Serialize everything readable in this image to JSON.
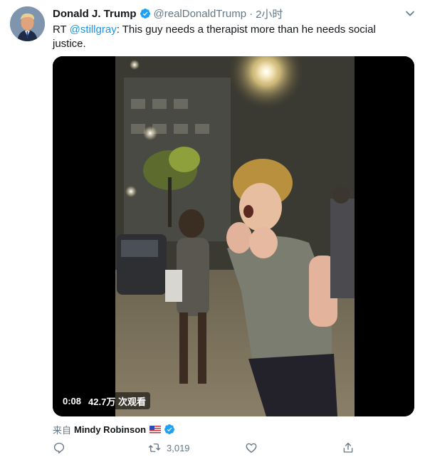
{
  "tweet": {
    "name": "Donald J. Trump",
    "handle": "@realDonaldTrump",
    "separator": "·",
    "time": "2小时",
    "text_prefix": "RT ",
    "mention": "@stillgray",
    "text_rest": ": This guy needs a therapist more than he needs social justice.",
    "video": {
      "duration": "0:08",
      "views": "42.7万 次观看"
    },
    "source": {
      "prefix": "来自",
      "user": "Mindy Robinson"
    },
    "actions": {
      "reply_count": "",
      "retweet_count": "3,019",
      "like_count": ""
    }
  },
  "colors": {
    "link": "#1b95e0",
    "verified": "#1da1f2",
    "muted": "#657786"
  },
  "icons": [
    "verified-badge-icon",
    "chevron-down-icon",
    "us-flag-icon",
    "reply-icon",
    "retweet-icon",
    "like-icon",
    "share-icon"
  ]
}
